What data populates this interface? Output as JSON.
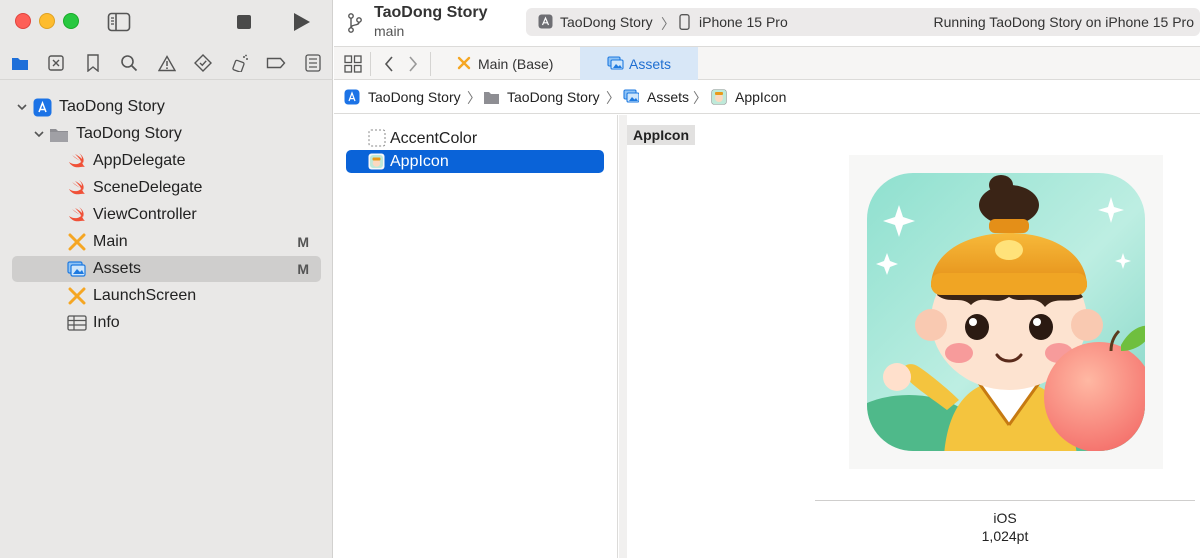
{
  "toolbar": {
    "project_title": "TaoDong Story",
    "branch": "main",
    "scheme": {
      "project": "TaoDong Story",
      "separator": "〉",
      "device": "iPhone 15 Pro"
    },
    "status": "Running TaoDong Story on iPhone 15 Pro"
  },
  "tabs": [
    {
      "label": "Main (Base)",
      "active": false
    },
    {
      "label": "Assets",
      "active": true
    }
  ],
  "breadcrumb": {
    "items": [
      "TaoDong Story",
      "TaoDong Story",
      "Assets",
      "AppIcon"
    ],
    "separator": "〉"
  },
  "navigator": {
    "items": [
      {
        "label": "TaoDong Story",
        "icon": "app-project-icon",
        "level": 0,
        "expanded": true
      },
      {
        "label": "TaoDong Story",
        "icon": "folder-icon",
        "level": 1,
        "expanded": true
      },
      {
        "label": "AppDelegate",
        "icon": "swift-file-icon",
        "level": 2
      },
      {
        "label": "SceneDelegate",
        "icon": "swift-file-icon",
        "level": 2
      },
      {
        "label": "ViewController",
        "icon": "swift-file-icon",
        "level": 2
      },
      {
        "label": "Main",
        "icon": "storyboard-icon",
        "level": 2,
        "badge": "M"
      },
      {
        "label": "Assets",
        "icon": "asset-catalog-icon",
        "level": 2,
        "badge": "M",
        "selected": true
      },
      {
        "label": "LaunchScreen",
        "icon": "storyboard-icon",
        "level": 2
      },
      {
        "label": "Info",
        "icon": "plist-table-icon",
        "level": 2
      }
    ]
  },
  "assets": {
    "items": [
      {
        "label": "AccentColor",
        "icon": "color-set-icon"
      },
      {
        "label": "AppIcon",
        "icon": "app-icon-thumbnail",
        "selected": true
      }
    ]
  },
  "detail": {
    "set_name": "AppIcon",
    "slot_platform": "iOS",
    "slot_size": "1,024pt"
  },
  "colors": {
    "accent": "#0a63d8",
    "tab_active_bg": "#d8e7f7",
    "swift_orange": "#f05138",
    "storyboard_yellow": "#f5a623"
  }
}
